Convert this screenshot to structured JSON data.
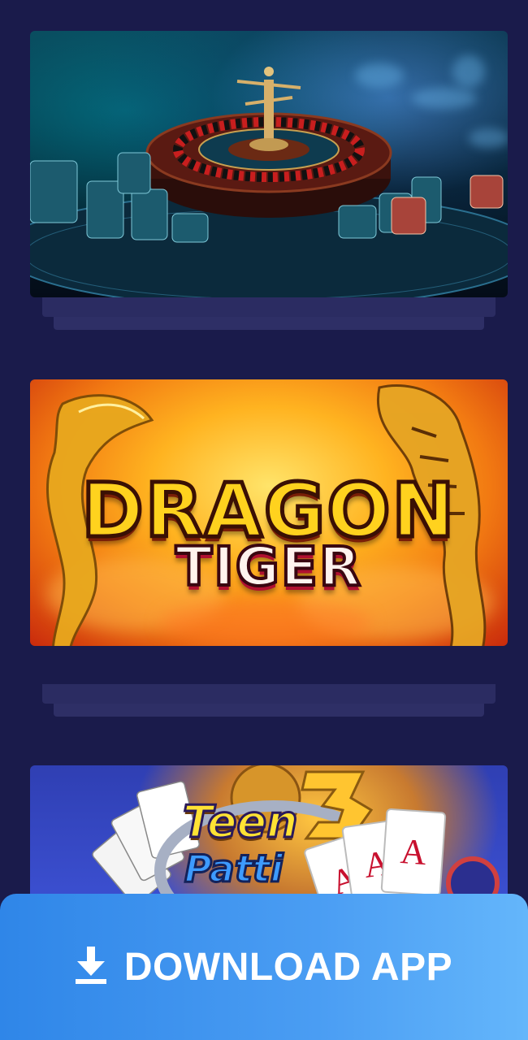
{
  "games": [
    {
      "name": "roulette-card",
      "image_icon": "roulette-wheel-image"
    },
    {
      "name": "dragon-tiger-card",
      "image_icon": "dragon-tiger-image",
      "title_line1": "DRAGON",
      "title_line2": "TIGER"
    },
    {
      "name": "teen-patti-card",
      "image_icon": "teen-patti-image",
      "title_line1": "Teen",
      "title_line2": "Patti",
      "badge": "3",
      "card_rank": "A"
    }
  ],
  "download": {
    "label": "DOWNLOAD APP",
    "icon": "download-icon"
  },
  "colors": {
    "background": "#1a1b4b",
    "download_bar": "#4a9df3",
    "dragon_text": "#ffd21e"
  }
}
